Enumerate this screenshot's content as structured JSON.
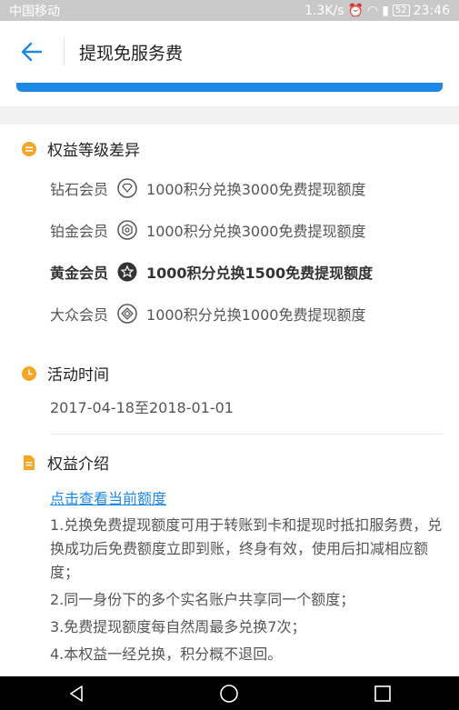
{
  "status": {
    "carrier": "中国移动",
    "speed": "1.3K/s",
    "battery": "52",
    "time": "23:46"
  },
  "header": {
    "title": "提现免服务费"
  },
  "colors": {
    "accent": "#1e88e5",
    "orange": "#f5a623"
  },
  "levels": {
    "title": "权益等级差异",
    "rows": [
      {
        "name": "钻石会员",
        "desc": "1000积分兑换3000免费提现额度",
        "icon": "diamond-badge-icon"
      },
      {
        "name": "铂金会员",
        "desc": "1000积分兑换3000免费提现额度",
        "icon": "platinum-badge-icon"
      },
      {
        "name": "黄金会员",
        "desc": "1000积分兑换1500免费提现额度",
        "icon": "gold-badge-icon",
        "current": true
      },
      {
        "name": "大众会员",
        "desc": "1000积分兑换1000免费提现额度",
        "icon": "public-badge-icon"
      }
    ]
  },
  "activity": {
    "title": "活动时间",
    "date": "2017-04-18至2018-01-01"
  },
  "intro": {
    "title": "权益介绍",
    "link": "点击查看当前额度",
    "items": [
      "1.兑换免费提现额度可用于转账到卡和提现时抵扣服务费，兑换成功后免费额度立即到账，终身有效，使用后扣减相应额度；",
      "2.同一身份下的多个实名账户共享同一个额度；",
      "3.免费提现额度每自然周最多兑换7次；",
      "4.本权益一经兑换，积分概不退回。"
    ]
  }
}
